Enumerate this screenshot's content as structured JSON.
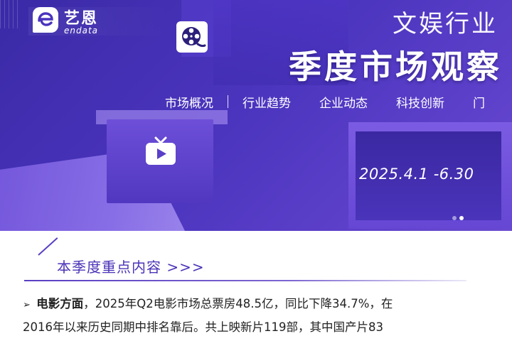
{
  "brand": {
    "name_cn": "艺恩",
    "name_en": "endata",
    "logo_letter": "e"
  },
  "banner": {
    "title_small": "文娱行业",
    "title_big": "季度市场观察",
    "nav": [
      "市场概况",
      "行业趋势",
      "企业动态",
      "科技创新",
      "门"
    ],
    "date": "2025.4.1  -6.30",
    "active_slide": 1,
    "slide_count": 2
  },
  "section": {
    "title": "本季度重点内容",
    "arrows": ">>>"
  },
  "content": {
    "bullet": "➢",
    "label": "电影方面",
    "text_line1": "，2025年Q2电影市场总票房48.5亿，同比下降34.7%，在",
    "text_line2": "2016年以来历史同期中排名靠后。共上映新片119部，其中国产片83"
  },
  "icons": {
    "film": "film-reel-icon",
    "tv": "tv-play-icon"
  },
  "colors": {
    "banner_primary": "#4a34bd",
    "accent": "#4b33b8",
    "text": "#222222"
  }
}
